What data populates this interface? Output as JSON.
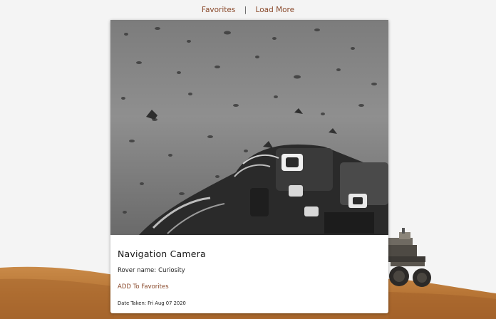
{
  "nav": {
    "favorites_label": "Favorites",
    "separator": "|",
    "load_more_label": "Load More"
  },
  "card": {
    "camera_name": "Navigation Camera",
    "rover_label": "Rover name:",
    "rover_name": "Curiosity",
    "add_favorites_label": "ADD To Favorites",
    "date_label": "Date Taken:",
    "date_value": "Fri Aug 07 2020"
  },
  "colors": {
    "link": "#8a4a2c",
    "page_background": "#f4f4f4",
    "card_background": "#ffffff",
    "mars_ground": "#b8793a"
  }
}
